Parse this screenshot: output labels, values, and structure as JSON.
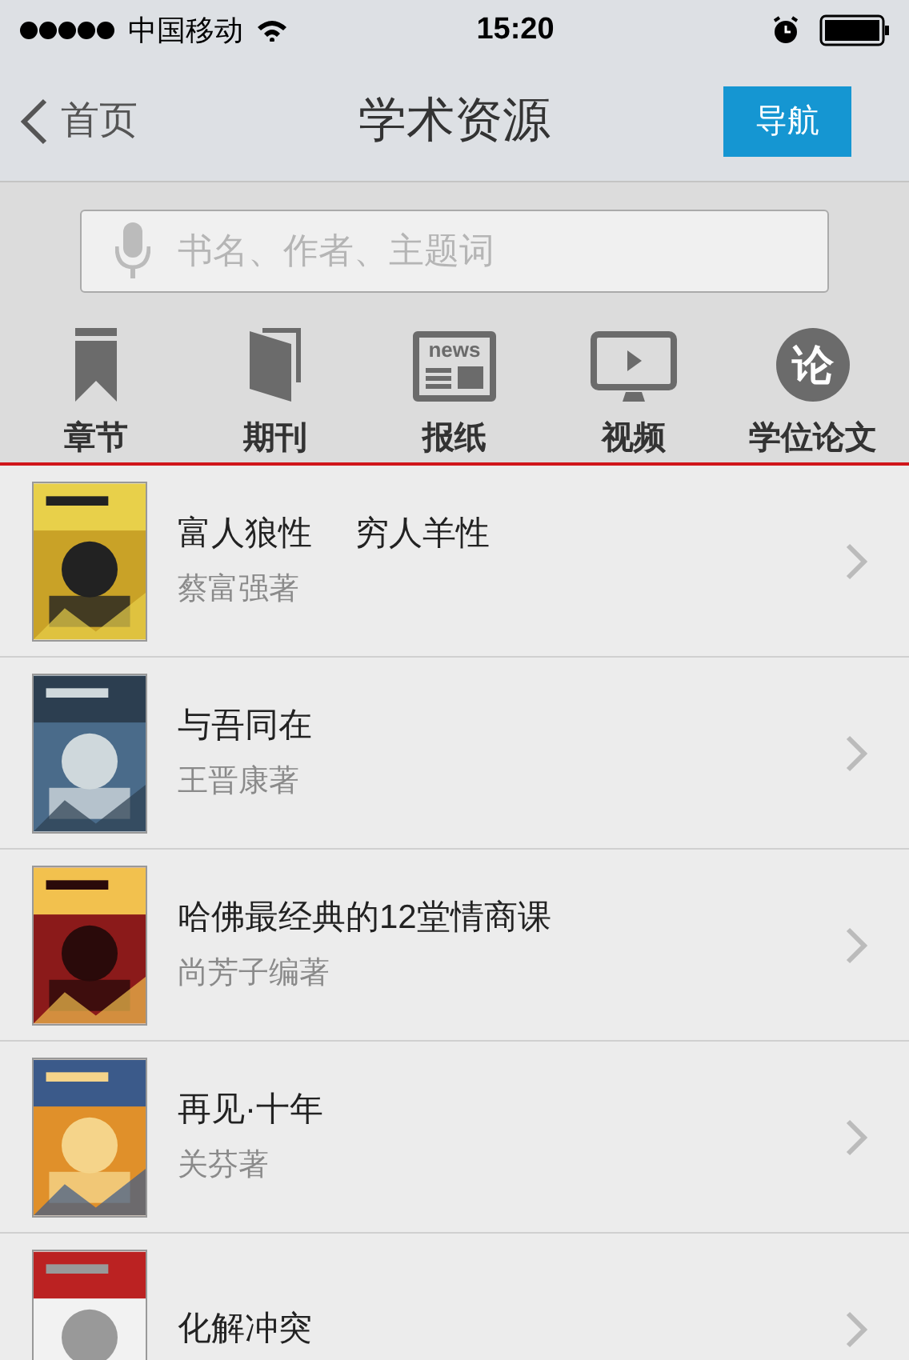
{
  "status_bar": {
    "carrier": "中国移动",
    "time": "15:20"
  },
  "nav": {
    "back": "首页",
    "title": "学术资源",
    "action": "导航"
  },
  "search": {
    "placeholder": "书名、作者、主题词"
  },
  "categories": [
    {
      "kind": "bookmark",
      "label": "章节"
    },
    {
      "kind": "book",
      "label": "期刊"
    },
    {
      "kind": "newspaper",
      "label": "报纸",
      "icon_text": "news"
    },
    {
      "kind": "video",
      "label": "视频"
    },
    {
      "kind": "seal",
      "label": "学位论文",
      "icon_text": "论"
    }
  ],
  "books": [
    {
      "title": "富人狼性　 穷人羊性",
      "author": "蔡富强著"
    },
    {
      "title": "与吾同在",
      "author": "王晋康著"
    },
    {
      "title": "哈佛最经典的12堂情商课",
      "author": "尚芳子编著"
    },
    {
      "title": "再见·十年",
      "author": "关芬著"
    },
    {
      "title": "化解冲突"
    }
  ]
}
